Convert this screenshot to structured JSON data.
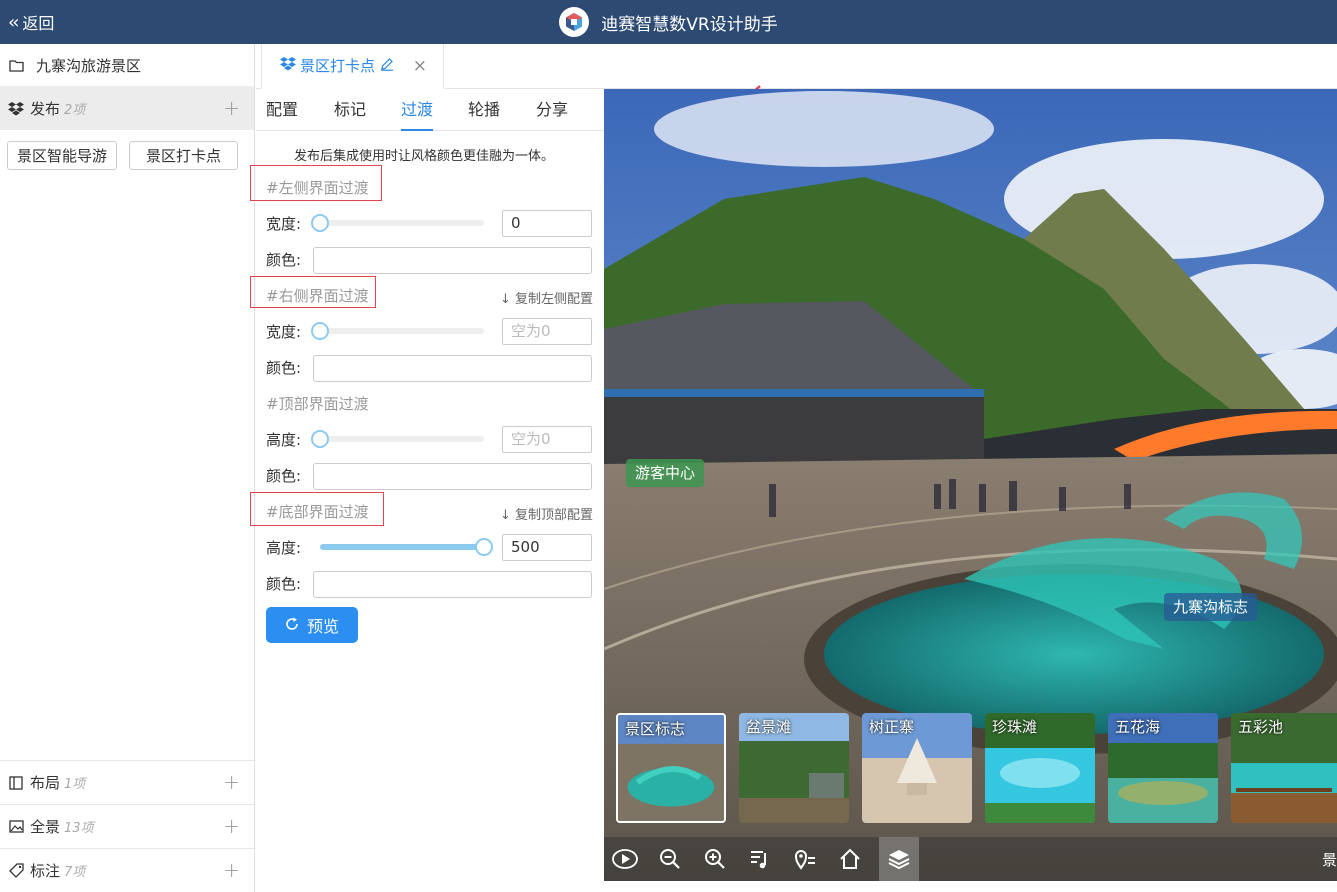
{
  "header": {
    "back_label": "返回",
    "app_title": "迪赛智慧数VR设计助手"
  },
  "sidebar": {
    "project": "九寨沟旅游景区",
    "publish": {
      "label": "发布",
      "count": "2项",
      "buttons": [
        "景区智能导游",
        "景区打卡点"
      ]
    },
    "sections": [
      {
        "label": "布局",
        "count": "1项",
        "icon": "layout-icon"
      },
      {
        "label": "全景",
        "count": "13项",
        "icon": "image-icon"
      },
      {
        "label": "标注",
        "count": "7项",
        "icon": "tag-icon"
      }
    ]
  },
  "file_tab": {
    "label": "景区打卡点"
  },
  "subtabs": [
    "配置",
    "标记",
    "过渡",
    "轮播",
    "分享"
  ],
  "active_subtab": "过渡",
  "panel": {
    "description": "发布后集成使用时让风格颜色更佳融为一体。",
    "width_label": "宽度:",
    "height_label": "高度:",
    "color_label": "颜色:",
    "left": {
      "title": "#左侧界面过渡",
      "value": "0",
      "level": 0
    },
    "right": {
      "title": "#右侧界面过渡",
      "copy": "复制左侧配置",
      "placeholder": "空为0",
      "level": 0
    },
    "top": {
      "title": "#顶部界面过渡",
      "placeholder": "空为0",
      "level": 0
    },
    "bottom": {
      "title": "#底部界面过渡",
      "copy": "复制顶部配置",
      "value": "500",
      "level": 1
    },
    "preview_button": "预览"
  },
  "pano": {
    "hotspots": [
      "游客中心",
      "九寨沟标志"
    ],
    "thumbnails": [
      "景区标志",
      "盆景滩",
      "树正寨",
      "珍珠滩",
      "五花海",
      "五彩池"
    ],
    "toolbar_edge_text": "景"
  },
  "colors": {
    "header": "#2d4a73",
    "accent": "#2b87e8",
    "highlight_box": "#e0474c"
  }
}
